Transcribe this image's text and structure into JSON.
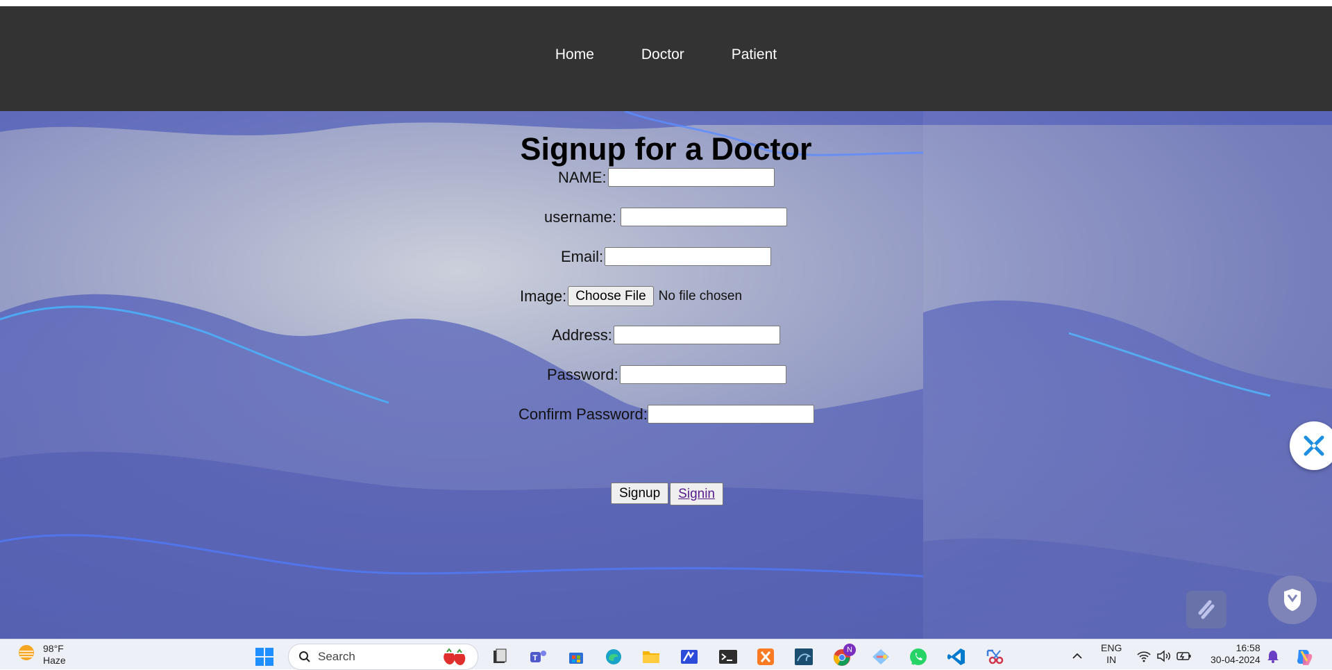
{
  "nav": {
    "items": [
      "Home",
      "Doctor",
      "Patient"
    ]
  },
  "form": {
    "title": "Signup for a Doctor",
    "name_label": "NAME:",
    "username_label": "username:",
    "email_label": "Email:",
    "image_label": "Image:",
    "file_button": "Choose File",
    "file_status": "No file chosen",
    "address_label": "Address:",
    "password_label": "Password:",
    "confirm_label": "Confirm Password:",
    "name_value": "",
    "username_value": "",
    "email_value": "",
    "address_value": "",
    "password_value": "",
    "confirm_value": "",
    "signup_button": "Signup",
    "signin_link": "Signin"
  },
  "taskbar": {
    "weather_temp": "98°F",
    "weather_cond": "Haze",
    "search_placeholder": "Search",
    "lang_top": "ENG",
    "lang_bottom": "IN",
    "time": "16:58",
    "date": "30-04-2024",
    "chrome_badge": "N"
  },
  "colors": {
    "navbar": "#333333",
    "nav_text": "#ffffff",
    "link_visited": "#551a8b",
    "background_blue": "#6f78b8"
  },
  "icons": [
    "start-icon",
    "search-icon",
    "files-icon",
    "teams-icon",
    "store-icon",
    "edge-icon",
    "folder-icon",
    "app-icon",
    "terminal-icon",
    "xampp-icon",
    "mysql-icon",
    "chrome-icon",
    "git-icon",
    "whatsapp-icon",
    "vscode-icon",
    "snip-icon"
  ]
}
